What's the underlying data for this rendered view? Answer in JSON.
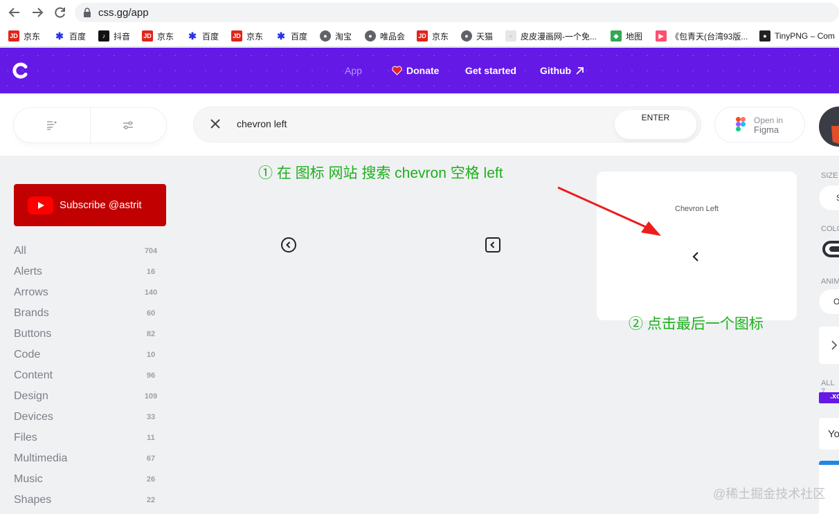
{
  "browser": {
    "url": "css.gg/app",
    "bookmarks": [
      "京东",
      "百度",
      "抖音",
      "京东",
      "百度",
      "京东",
      "百度",
      "淘宝",
      "唯品会",
      "京东",
      "天猫",
      "皮皮漫画网-一个免...",
      "地图",
      "《包青天(台湾93版...",
      "TinyPNG – Com"
    ]
  },
  "header": {
    "nav": {
      "app": "App",
      "donate": "Donate",
      "get_started": "Get started",
      "github": "Github"
    }
  },
  "search": {
    "value": "chevron left",
    "enter_label": "ENTER"
  },
  "figma": {
    "line1": "Open in",
    "line2": "Figma"
  },
  "sidebar": {
    "subscribe_label": "Subscribe @astrit",
    "categories": [
      {
        "name": "All",
        "count": "704"
      },
      {
        "name": "Alerts",
        "count": "16"
      },
      {
        "name": "Arrows",
        "count": "140"
      },
      {
        "name": "Brands",
        "count": "60"
      },
      {
        "name": "Buttons",
        "count": "82"
      },
      {
        "name": "Code",
        "count": "10"
      },
      {
        "name": "Content",
        "count": "96"
      },
      {
        "name": "Design",
        "count": "109"
      },
      {
        "name": "Devices",
        "count": "33"
      },
      {
        "name": "Files",
        "count": "11"
      },
      {
        "name": "Multimedia",
        "count": "67"
      },
      {
        "name": "Music",
        "count": "26"
      },
      {
        "name": "Shapes",
        "count": "22"
      }
    ]
  },
  "preview": {
    "title": "Chevron Left"
  },
  "annotations": {
    "step1": "① 在 图标 网站 搜索 chevron 空格 left",
    "step2": "② 点击最后一个图标"
  },
  "right_panel": {
    "size_label": "SIZE",
    "size_value": "S",
    "color_label": "COLO",
    "anim_label": "ANIM",
    "anim_value": "O",
    "all_label": "ALL 7",
    "tag": ".xc",
    "input_text": "Yo"
  },
  "watermark": "@稀土掘金技术社区",
  "colors": {
    "brand": "#6419e6",
    "youtube": "#c10001",
    "annotation": "#1cb01c",
    "arrow": "#ee1c1c"
  }
}
